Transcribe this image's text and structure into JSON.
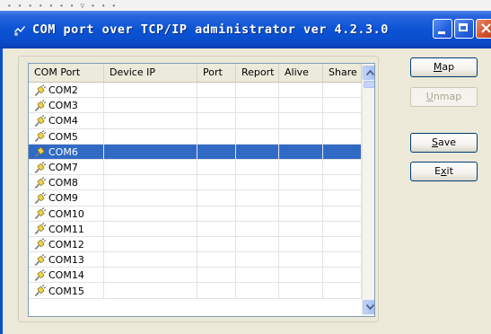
{
  "window": {
    "title": "COM port over TCP/IP administrator ver 4.2.3.0",
    "background_scribble": "∙ ∙ ∙ ∙ ∙ ∙ ∙ ▽ ∙ ∙ ∙"
  },
  "list": {
    "columns": [
      "COM Port",
      "Device IP",
      "Port",
      "Report",
      "Alive",
      "Share"
    ],
    "selected_port": "COM6",
    "rows": [
      {
        "port": "COM2"
      },
      {
        "port": "COM3"
      },
      {
        "port": "COM4"
      },
      {
        "port": "COM5"
      },
      {
        "port": "COM6"
      },
      {
        "port": "COM7"
      },
      {
        "port": "COM8"
      },
      {
        "port": "COM9"
      },
      {
        "port": "COM10"
      },
      {
        "port": "COM11"
      },
      {
        "port": "COM12"
      },
      {
        "port": "COM13"
      },
      {
        "port": "COM14"
      },
      {
        "port": "COM15"
      }
    ]
  },
  "buttons": {
    "map": {
      "accel": "M",
      "rest": "ap",
      "enabled": true
    },
    "unmap": {
      "accel": "U",
      "rest": "nmap",
      "enabled": false
    },
    "save": {
      "accel": "S",
      "rest": "ave",
      "enabled": true
    },
    "exit": {
      "accel_pre": "E",
      "accel": "x",
      "rest": "it",
      "enabled": true
    }
  },
  "icons": {
    "app": "app-icon",
    "row": "serial-plug-icon",
    "minimize": "minimize-icon",
    "maximize": "maximize-icon",
    "close": "close-icon"
  },
  "colors": {
    "titlebar": "#0b53d4",
    "selection": "#316ac5",
    "close_button": "#d2522d"
  }
}
